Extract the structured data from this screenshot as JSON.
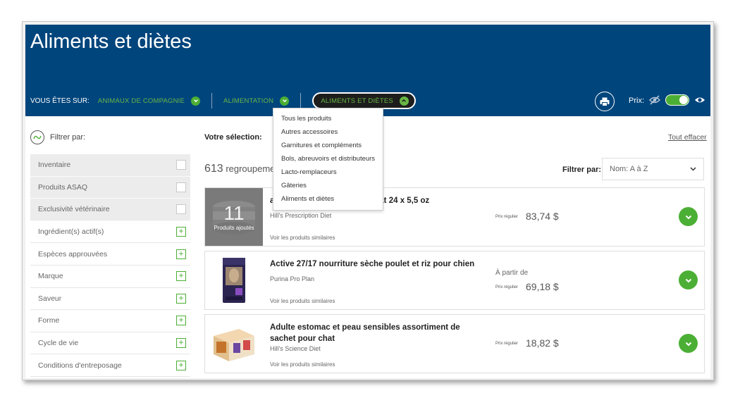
{
  "header": {
    "title": "Aliments et diètes",
    "breadcrumb_label": "VOUS ÊTES SUR:",
    "breadcrumb": [
      {
        "label": "ANIMAUX DE COMPAGNIE"
      },
      {
        "label": "ALIMENTATION"
      },
      {
        "label": "ALIMENTS ET DIÈTES"
      }
    ],
    "price_label": "Prix:",
    "price_toggle_on": true
  },
  "dropdown": {
    "items": [
      "Tous les produits",
      "Autres accessoires",
      "Garnitures et compléments",
      "Bols, abreuvoirs et distributeurs",
      "Lacto-remplaceurs",
      "Gâteries",
      "Aliments et diètes"
    ]
  },
  "sidebar": {
    "filter_label": "Filtrer par:",
    "checkbox_filters": [
      "Inventaire",
      "Produits ASAQ",
      "Exclusivité vétérinaire"
    ],
    "expand_filters": [
      "Ingrédient(s) actif(s)",
      "Espèces approuvées",
      "Marque",
      "Saveur",
      "Forme",
      "Cycle de vie",
      "Conditions d'entreposage"
    ]
  },
  "main": {
    "selection_label": "Votre sélection:",
    "clear_all": "Tout effacer",
    "count_number": "613",
    "count_text": " regroupeme",
    "sort_label": "Filtrer par:",
    "sort_value": "Nom: A à Z"
  },
  "products": [
    {
      "name": "a                                  hien/chat 24 x 5,5 oz",
      "brand": "Hill's Prescription Diet",
      "similar": "Voir les produits similaires",
      "from": "",
      "regular_label": "Prix régulier",
      "price": "83,74 $",
      "added_count": "11",
      "added_text": "Produits ajoutés"
    },
    {
      "name": "Active 27/17 nourriture sèche poulet et riz pour chien",
      "brand": "Purina Pro Plan",
      "similar": "Voir les produits similaires",
      "from": "À partir de",
      "regular_label": "Prix régulier",
      "price": "69,18 $"
    },
    {
      "name": "Adulte estomac et peau sensibles assortiment de sachet pour chat",
      "brand": "Hill's Science Diet",
      "similar": "Voir les produits similaires",
      "from": "",
      "regular_label": "Prix régulier",
      "price": "18,82 $"
    }
  ],
  "colors": {
    "header_bg": "#00457c",
    "accent_green": "#4caf35",
    "breadcrumb_green": "#69b746"
  }
}
